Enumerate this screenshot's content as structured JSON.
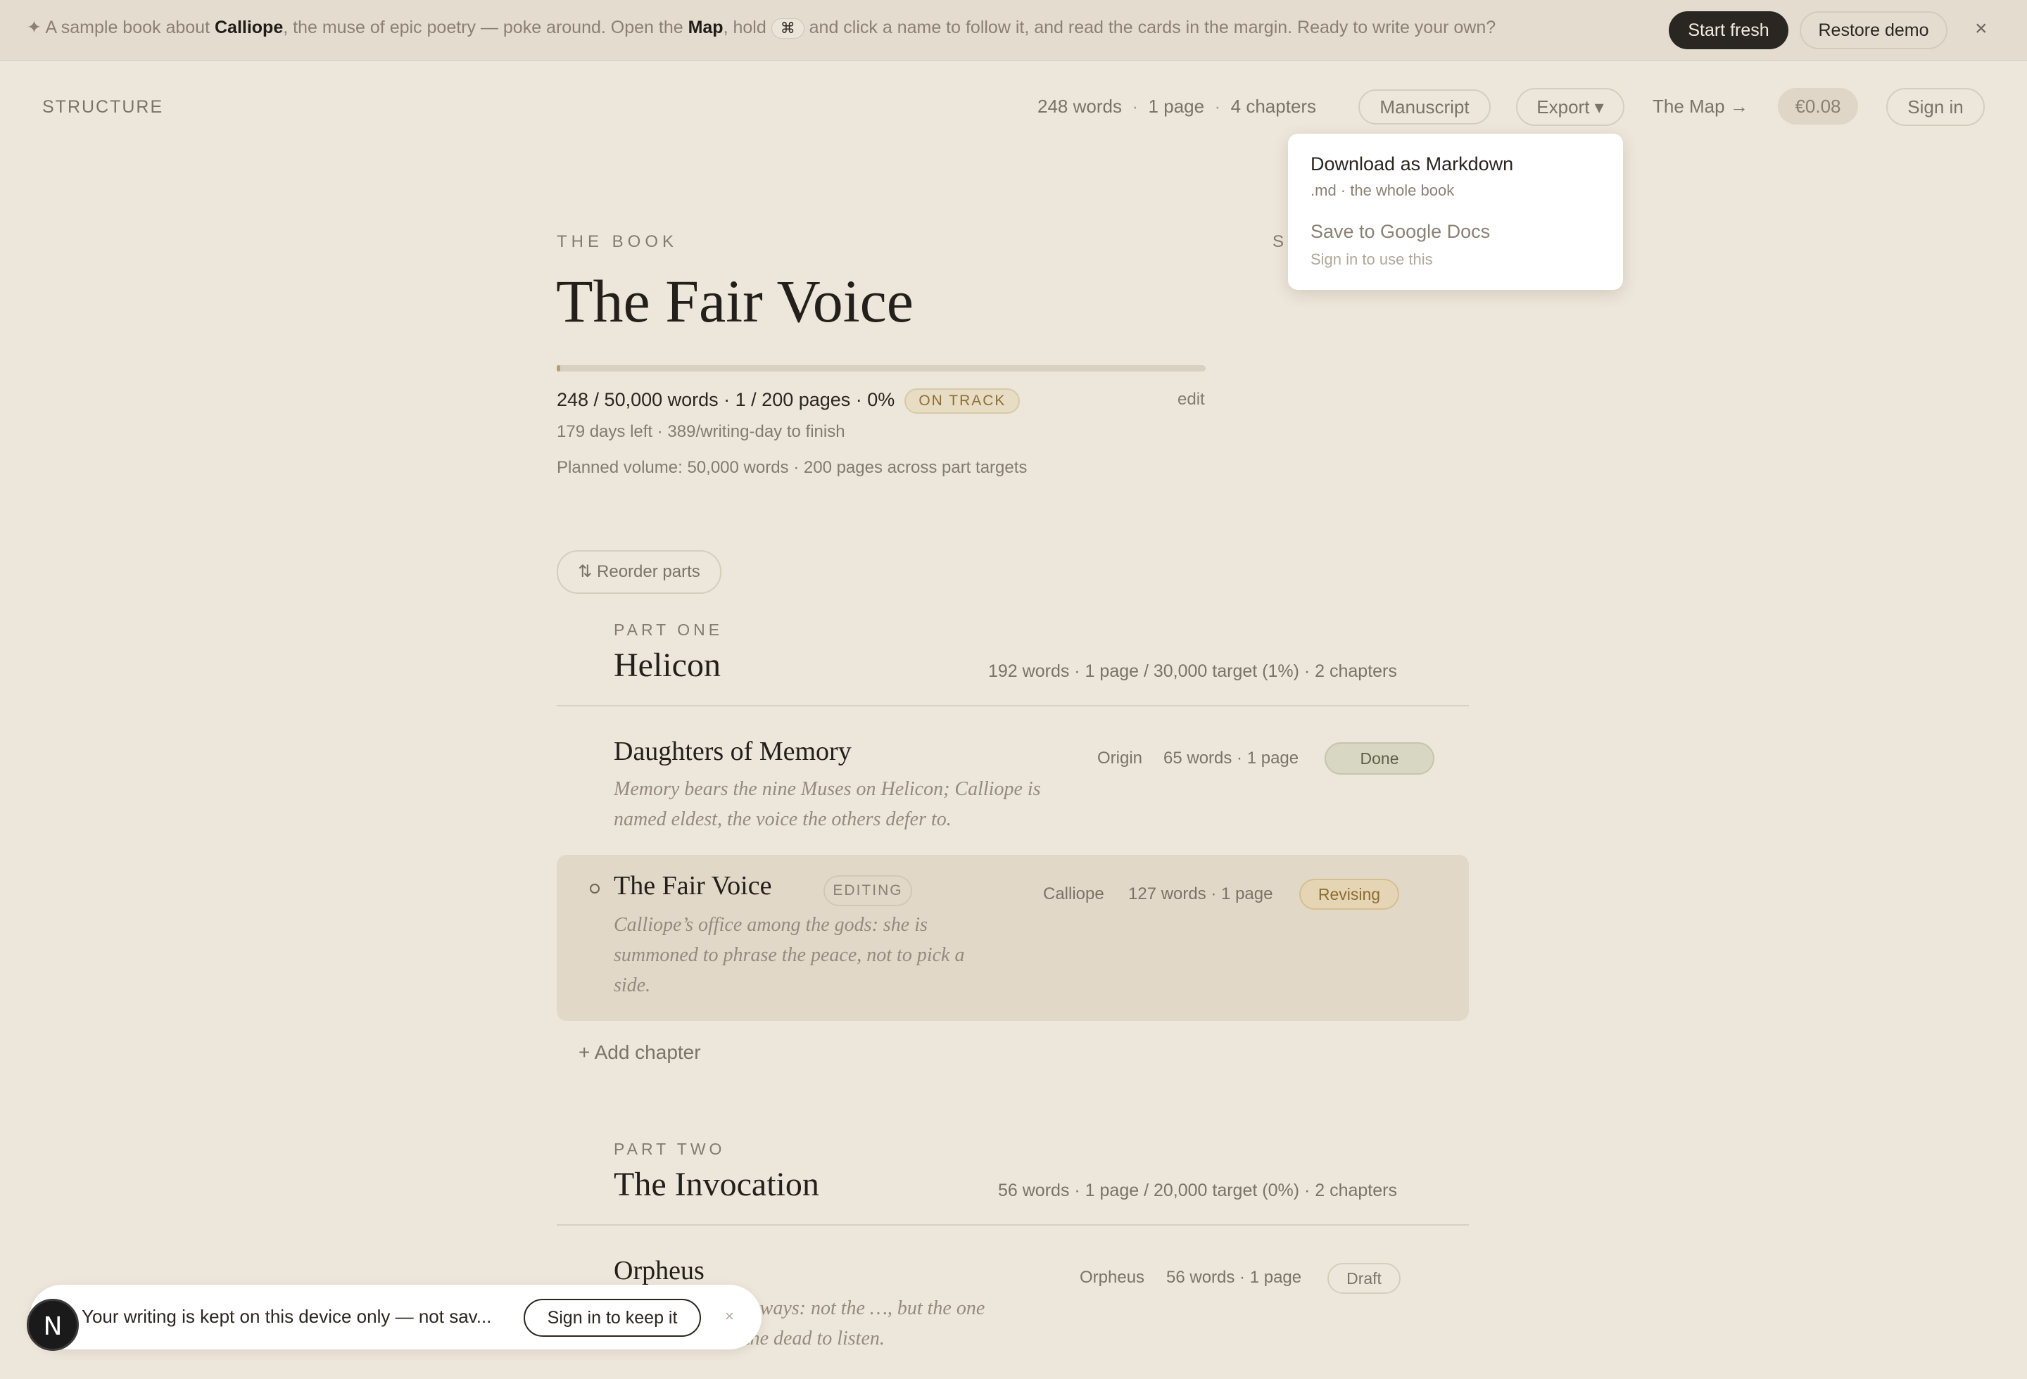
{
  "banner": {
    "sparkle": "✦",
    "pre": "A sample book about ",
    "b1": "Calliope",
    "mid1": ", the muse of epic poetry — poke around. Open the ",
    "b2": "Map",
    "mid2": ", hold ",
    "key": "⌘",
    "post": " and click a name to follow it, and read the cards in the margin. Ready to write your own?",
    "start_fresh": "Start fresh",
    "restore_demo": "Restore demo",
    "close": "×"
  },
  "header": {
    "section": "STRUCTURE",
    "words": "248 words",
    "pages": "1 page",
    "chapters": "4 chapters",
    "sep": "·",
    "manuscript": "Manuscript",
    "export": "Export ▾",
    "map": "The Map →",
    "price": "€0.08",
    "signin": "Sign in"
  },
  "export_menu": {
    "item1_title": "Download as Markdown",
    "item1_sub": ".md · the whole book",
    "item2_title": "Save to Google Docs",
    "item2_sub": "Sign in to use this"
  },
  "book": {
    "kicker": "THE BOOK",
    "side_kicker": "S",
    "title": "The Fair Voice",
    "progress_pct": 0.5,
    "progress_line": "248 / 50,000 words · 1 / 200 pages · 0%",
    "status": "ON TRACK",
    "edit": "edit",
    "days_line": "179 days left · 389/writing-day to finish",
    "planned_line": "Planned volume: 50,000 words · 200 pages across part targets",
    "reorder": "⇅ Reorder parts"
  },
  "parts": [
    {
      "kicker": "PART ONE",
      "title": "Helicon",
      "stats": "192 words · 1 page / 30,000 target (1%) · 2 chapters",
      "chapters": [
        {
          "title": "Daughters of Memory",
          "desc": "Memory bears the nine Muses on Helicon; Calliope is named eldest, the voice the others defer to.",
          "pov": "Origin",
          "meta": "65 words · 1 page",
          "status": "Done"
        },
        {
          "title": "The Fair Voice",
          "tag": "EDITING",
          "desc": "Calliope’s office among the gods: she is summoned to phrase the peace, not to pick a side.",
          "pov": "Calliope",
          "meta": "127 words · 1 page",
          "status": "Revising"
        }
      ],
      "add_chapter": "+ Add chapter"
    },
    {
      "kicker": "PART TWO",
      "title": "The Invocation",
      "stats": "56 words · 1 page / 20,000 target (0%) · 2 chapters",
      "chapters": [
        {
          "title": "Orpheus",
          "desc": "…ries her gift sideways: not the …, but the one that moves even the dead to listen.",
          "pov": "Orpheus",
          "meta": "56 words · 1 page",
          "status": "Draft"
        }
      ]
    }
  ],
  "toast": {
    "logo": "N",
    "text": "Your writing is kept on this device only — not sav...",
    "button": "Sign in to keep it",
    "close": "×"
  }
}
